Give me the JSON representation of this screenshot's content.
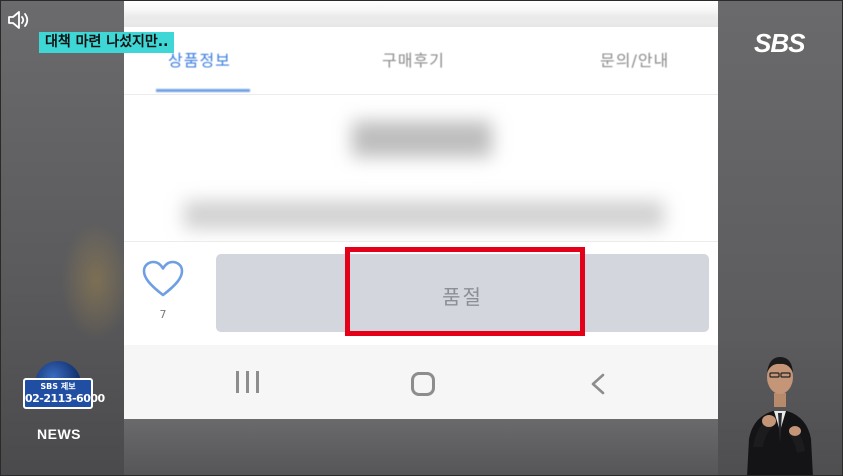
{
  "broadcast": {
    "caption": "대책 마련 나섰지만..",
    "channel_logo": "SBS",
    "tip_title": "SBS 제보",
    "tip_number": "02-2113-6000",
    "news_label": "NEWS"
  },
  "phone": {
    "tabs": [
      {
        "label": "상품정보",
        "active": true
      },
      {
        "label": "구매후기",
        "active": false
      },
      {
        "label": "문의/안내",
        "active": false
      }
    ],
    "like_count": "7",
    "soldout_label": "품절",
    "nav_icons": [
      "recent-apps-icon",
      "home-icon",
      "back-icon"
    ]
  },
  "colors": {
    "highlight": "#e5001a",
    "caption_bg": "#3fd7d6",
    "tab_active": "#3d7ee0",
    "button_bg": "#d3d6dc"
  }
}
